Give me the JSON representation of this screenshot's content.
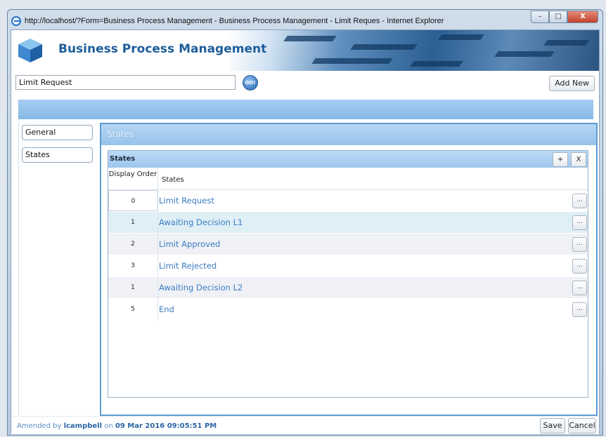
{
  "window": {
    "title": "http://localhost/?Form=Business Process Management - Business Process Management - Limit Reques - Internet Explorer",
    "controls": {
      "minimize": "–",
      "maximize": "□",
      "close": "X"
    }
  },
  "header": {
    "app_title": "Business Process Management"
  },
  "search": {
    "value": "Limit Request",
    "go_label": "GO!",
    "add_new_label": "Add New"
  },
  "sidebar": {
    "items": [
      {
        "label": "General"
      },
      {
        "label": "States"
      }
    ]
  },
  "panel": {
    "title": "States",
    "grid": {
      "title": "States",
      "add_label": "+",
      "remove_label": "X",
      "columns": {
        "order": "Display Order",
        "states": "States"
      },
      "rows": [
        {
          "order": "0",
          "name": "Limit Request",
          "action": "..."
        },
        {
          "order": "1",
          "name": "Awaiting Decision L1",
          "action": "..."
        },
        {
          "order": "2",
          "name": "Limit Approved",
          "action": "..."
        },
        {
          "order": "3",
          "name": "Limit Rejected",
          "action": "..."
        },
        {
          "order": "1",
          "name": "Awaiting Decision L2",
          "action": "..."
        },
        {
          "order": "5",
          "name": "End",
          "action": "..."
        }
      ]
    }
  },
  "footer": {
    "amended_prefix": "Amended by",
    "user": "lcampbell",
    "on_label": "on",
    "date": "09 Mar 2016 09:05:51 PM",
    "save_label": "Save",
    "cancel_label": "Cancel"
  },
  "colors": {
    "brand": "#1e5d9a",
    "accent": "#5e9bd2",
    "link": "#3a7cc2"
  }
}
